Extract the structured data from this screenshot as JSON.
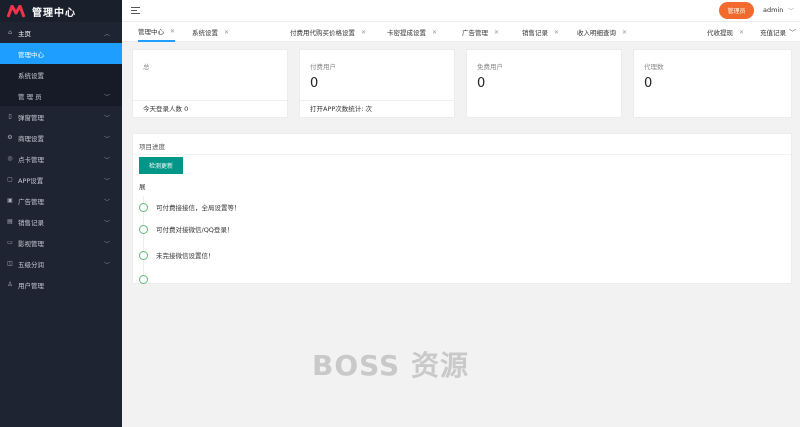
{
  "brand": {
    "title": "管理中心"
  },
  "sidebar": {
    "items": [
      {
        "label": "主页",
        "icon": "home-icon",
        "open": true,
        "children": [
          {
            "label": "管理中心",
            "active": true
          },
          {
            "label": "系统设置"
          },
          {
            "label": "管 理 员",
            "has_children": true
          }
        ]
      },
      {
        "label": "弹窗管理",
        "icon": "mobile-icon"
      },
      {
        "label": "商理设置",
        "icon": "gear-icon"
      },
      {
        "label": "点卡管理",
        "icon": "card-icon"
      },
      {
        "label": "APP设置",
        "icon": "app-icon"
      },
      {
        "label": "广告管理",
        "icon": "ad-icon"
      },
      {
        "label": "销售记录",
        "icon": "list-icon"
      },
      {
        "label": "影视管理",
        "icon": "video-icon"
      },
      {
        "label": "五级分润",
        "icon": "share-icon"
      },
      {
        "label": "用户管理",
        "icon": "user-icon"
      }
    ]
  },
  "header": {
    "admin_badge": "管理员",
    "admin_name": "admin"
  },
  "tabs": [
    {
      "label": "管理中心",
      "active": true
    },
    {
      "label": "系统设置"
    },
    {
      "label": "付费用代购买价格设置"
    },
    {
      "label": "卡密提成设置"
    },
    {
      "label": "广告管理"
    },
    {
      "label": "销售记录"
    },
    {
      "label": "收入明细查询"
    },
    {
      "label": "代收提现"
    },
    {
      "label": "充值记录"
    }
  ],
  "stats": [
    {
      "label": "总",
      "value": "",
      "foot": "今天登录人数  0"
    },
    {
      "label": "付费用户",
      "value": "0",
      "foot": "打开APP次数统计: 次"
    },
    {
      "label": "免费用户",
      "value": "0",
      "foot": ""
    },
    {
      "label": "代理数",
      "value": "0",
      "foot": ""
    }
  ],
  "progress": {
    "title": "项目进度",
    "button": "检测更新",
    "subtitle": "展",
    "items": [
      {
        "label": "可付费接接信，全局设置等！"
      },
      {
        "label": "可付费对接微信/QQ登录！"
      },
      {
        "label": "未完接微信设置信！"
      },
      {
        "label": ""
      }
    ]
  },
  "watermark": "BOSS 资源"
}
